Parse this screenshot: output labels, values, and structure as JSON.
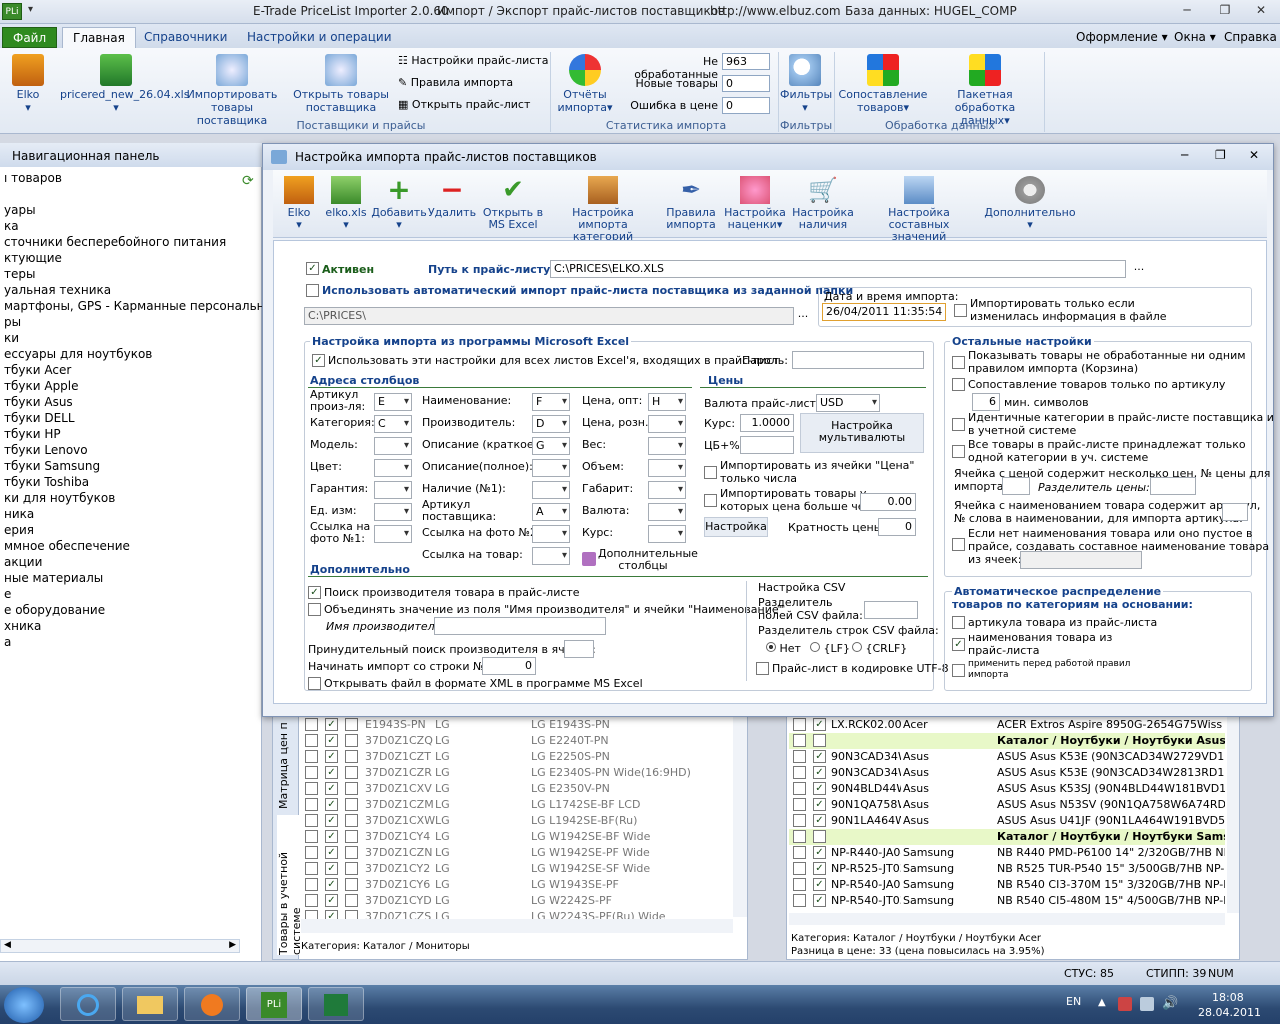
{
  "app": {
    "title_app": "E-Trade PriceList Importer 2.0.60",
    "title_desc": "Импорт / Экспорт прайс-листов поставщиков",
    "title_url": "http://www.elbuz.com",
    "title_db": "База данных: HUGEL_COMP",
    "logo": "PLi"
  },
  "tabs": {
    "file": "Файл",
    "main": "Главная",
    "refs": "Справочники",
    "settings": "Настройки и операции",
    "design": "Оформление",
    "windows": "Окна",
    "help": "Справка"
  },
  "ribbon": {
    "elko": "Elko",
    "file": "pricered_new_26.04.xls",
    "import1": "Импортировать",
    "import2": "товары поставщика",
    "open1": "Открыть товары",
    "open2": "поставщика",
    "set_price": "Настройки прайс-листа",
    "rules": "Правила импорта",
    "open_price": "Открыть прайс-лист",
    "grp1": "Поставщики и прайсы",
    "rep1": "Отчёты",
    "rep2": "импорта",
    "unproc_lbl": "Не обработанные",
    "unproc_val": "963",
    "new_lbl": "Новые товары",
    "new_val": "0",
    "err_lbl": "Ошибка в цене",
    "err_val": "0",
    "grp2": "Статистика импорта",
    "filt": "Фильтры",
    "grp3": "Фильтры",
    "match1": "Сопоставление",
    "match2": "товаров",
    "batch1": "Пакетная",
    "batch2": "обработка данных",
    "grp4": "Обработка данных"
  },
  "nav": {
    "header": "Навигационная панель",
    "items": [
      "ı товаров",
      "",
      "уары",
      "ка",
      "сточники бесперебойного питания",
      "ктующие",
      "теры",
      "уальная техника",
      "мартфоны, GPS - Карманные персональны",
      "ры",
      "ки",
      "ессуары для ноутбуков",
      "тбуки Acer",
      "тбуки Apple",
      "тбуки Asus",
      "тбуки DELL",
      "тбуки HP",
      "тбуки Lenovo",
      "тбуки Samsung",
      "тбуки Toshiba",
      "ки для ноутбуков",
      "ника",
      "ерия",
      "ммное обеспечение",
      "акции",
      "ные материалы",
      "е",
      "е оборудование",
      "хника",
      "а"
    ]
  },
  "left_grid": {
    "rows": [
      [
        "E1943S-PN",
        "LG",
        "LG E1943S-PN"
      ],
      [
        "37D0Z1CZQ",
        "LG",
        "LG E2240T-PN"
      ],
      [
        "37D0Z1CZT",
        "LG",
        "LG E2250S-PN"
      ],
      [
        "37D0Z1CZR",
        "LG",
        "LG E2340S-PN Wide(16:9HD)"
      ],
      [
        "37D0Z1CXV",
        "LG",
        "LG E2350V-PN"
      ],
      [
        "37D0Z1CZM",
        "LG",
        "LG L1742SE-BF LCD"
      ],
      [
        "37D0Z1CXW",
        "LG",
        "LG L1942SE-BF(Ru)"
      ],
      [
        "37D0Z1CY4",
        "LG",
        "LG W1942SE-BF Wide"
      ],
      [
        "37D0Z1CZN",
        "LG",
        "LG W1942SE-PF Wide"
      ],
      [
        "37D0Z1CY2",
        "LG",
        "LG W1942SE-SF Wide"
      ],
      [
        "37D0Z1CY6",
        "LG",
        "LG W1943SE-PF"
      ],
      [
        "37D0Z1CYD",
        "LG",
        "LG W2242S-PF"
      ],
      [
        "37D0Z1CZS",
        "LG",
        "LG W2243S-PF(Ru) Wide"
      ]
    ],
    "side1": "Матрица цен п",
    "side2": "Товары в учетной системе",
    "footer": "Категория: Каталог / Мониторы"
  },
  "right_grid": {
    "rows": [
      [
        "LX.RCK02.007",
        "Acer",
        "ACER Extros Aspire 8950G-2654G75Wiss Intel Core"
      ],
      [
        "",
        "",
        "Каталог / Ноутбуки / Ноутбуки Asus (5)"
      ],
      [
        "90N3CAD34W",
        "Asus",
        "ASUS Asus K53E (90N3CAD34W2729VD13AY) Cor"
      ],
      [
        "90N3CAD34W",
        "Asus",
        "ASUS Asus K53E (90N3CAD34W2813RD13AY) Cor"
      ],
      [
        "90N4BLD44W",
        "Asus",
        "ASUS Asus K53SJ (90N4BLD44W181BVD13AY) Cor"
      ],
      [
        "90N1QA758W",
        "Asus",
        "ASUS Asus N53SV (90N1QA758W6A74RD13AY) Cor"
      ],
      [
        "90N1LA464W",
        "Asus",
        "ASUS Asus U41JF (90N1LA464W191BVD53AY) Cor"
      ],
      [
        "",
        "",
        "Каталог / Ноутбуки / Ноутбуки Samsung"
      ],
      [
        "NP-R440-JA04",
        "Samsung",
        "NB R440 PMD-P6100 14\" 2/320GB/7HB NP-R440-J"
      ],
      [
        "NP-R525-JT03",
        "Samsung",
        "NB R525 TUR-P540 15\" 3/500GB/7HB NP-R525-JT0"
      ],
      [
        "NP-R540-JA08",
        "Samsung",
        "NB R540 CI3-370M 15\" 3/320GB/7HB NP-R540-JA"
      ],
      [
        "NP-R540-JT03",
        "Samsung",
        "NB R540 CI5-480M 15\" 4/500GB/7HB NP-R540-JT0"
      ]
    ],
    "footer1": "Категория: Каталог / Ноутбуки / Ноутбуки Acer",
    "footer2": "Разница в цене: 33  (цена повысилась на 3.95%)"
  },
  "dialog": {
    "title": "Настройка импорта прайс-листов поставщиков",
    "toolbar": {
      "elko": "Elko",
      "elko_xls": "elko.xls",
      "add": "Добавить",
      "del": "Удалить",
      "open_excel1": "Открыть в",
      "open_excel2": "MS Excel",
      "cat1": "Настройка импорта",
      "cat2": "категорий",
      "rules1": "Правила",
      "rules2": "импорта",
      "markup1": "Настройка",
      "markup2": "наценки",
      "avail1": "Настройка",
      "avail2": "наличия",
      "comp1": "Настройка составных",
      "comp2": "значений",
      "more": "Дополнительно"
    },
    "active": "Активен",
    "path_lbl": "Путь к прайс-листу:",
    "path_val": "C:\\PRICES\\ELKO.XLS",
    "auto_import": "Использовать автоматический импорт прайс-листа поставщика из заданной папки",
    "folder_val": "C:\\PRICES\\",
    "dt_lbl": "Дата и время импорта:",
    "dt_val": "26/04/2011 11:35:54",
    "only_changed1": "Импортировать только если",
    "only_changed2": "изменилась информация в файле",
    "excel_title": "Настройка импорта из программы Microsoft Excel",
    "all_sheets": "Использовать эти настройки для всех листов Excel'я, входящих в прайс-лист",
    "password": "Пароль:",
    "addr_title": "Адреса столбцов",
    "col1": [
      {
        "l1": "Артикул",
        "l2": "произ-ля:",
        "v": "E"
      },
      {
        "l1": "Категория:",
        "v": "C"
      },
      {
        "l1": "Модель:",
        "v": ""
      },
      {
        "l1": "Цвет:",
        "v": ""
      },
      {
        "l1": "Гарантия:",
        "v": ""
      },
      {
        "l1": "Ед. изм:",
        "v": ""
      },
      {
        "l1": "Ссылка на",
        "l2": "фото №1:",
        "v": ""
      }
    ],
    "col2": [
      {
        "l1": "Наименование:",
        "v": "F"
      },
      {
        "l1": "Производитель:",
        "v": "D"
      },
      {
        "l1": "Описание (краткое):",
        "v": "G"
      },
      {
        "l1": "Описание(полное):",
        "v": ""
      },
      {
        "l1": "Наличие (№1):",
        "v": ""
      },
      {
        "l1": "Артикул",
        "l2": "поставщика:",
        "v": "A"
      },
      {
        "l1": "Ссылка на фото №2:",
        "v": ""
      },
      {
        "l1": "Ссылка на товар:",
        "v": ""
      }
    ],
    "col3": [
      {
        "l1": "Цена, опт:",
        "v": "H"
      },
      {
        "l1": "Цена, розн.:",
        "v": ""
      },
      {
        "l1": "Вес:",
        "v": ""
      },
      {
        "l1": "Объем:",
        "v": ""
      },
      {
        "l1": "Габарит:",
        "v": ""
      },
      {
        "l1": "Валюта:",
        "v": ""
      },
      {
        "l1": "Курс:",
        "v": ""
      }
    ],
    "extra_cols1": "Дополнительные",
    "extra_cols2": "столбцы",
    "prices_title": "Цены",
    "currency_lbl": "Валюта прайс-листа:",
    "currency_val": "USD",
    "rate_lbl": "Курс:",
    "rate_val": "1.0000",
    "cb_lbl": "ЦБ+%",
    "multi1": "Настройка",
    "multi2": "мультивалюты",
    "only_nums1": "Импортировать из ячейки \"Цена\"",
    "only_nums2": "только числа",
    "gt1": "Импортировать товары у",
    "gt2": "которых цена больше чем:",
    "gt_val": "0.00",
    "setup": "Настройка",
    "mult_lbl": "Кратность цены:",
    "mult_val": "0",
    "extra_title": "Дополнительно",
    "find_maker": "Поиск производителя товара в прайс-листе",
    "merge": "Объединять значение из поля \"Имя производителя\" и ячейки \"Наименование\"",
    "maker_name": "Имя производителя:",
    "forced": "Принудительный поиск производителя в ячейке:",
    "start_row": "Начинать импорт со строки №:",
    "start_val": "0",
    "xml": "Открывать файл в формате XML в программе MS Excel",
    "csv_title": "Настройка CSV",
    "csv_sep1": "Разделитель",
    "csv_sep2": "полей CSV файла:",
    "csv_rows": "Разделитель строк CSV файла:",
    "r_none": "Нет",
    "r_lf": "{LF}",
    "r_crlf": "{CRLF}",
    "utf8": "Прайс-лист в кодировке UTF-8",
    "other_title": "Остальные настройки",
    "o1a": "Показывать товары не обработанные ни одним",
    "o1b": "правилом импорта (Корзина)",
    "o2": "Сопоставление товаров только по артикулу",
    "o2n": "6",
    "o2s": "мин. символов",
    "o3a": "Идентичные категории в прайс-листе поставщика и",
    "o3b": "в учетной системе",
    "o4a": "Все товары в прайс-листе принадлежат только",
    "o4b": "одной категории в уч. системе",
    "o5a": "Ячейка с ценой содержит несколько цен, № цены для",
    "o5b": "импорта:",
    "o5c": "Разделитель цены:",
    "o6a": "Ячейка с наименованием товара содержит артикул,",
    "o6b": "№ слова в наименовании, для импорта артикула:",
    "o7a": "Если нет наименования товара или оно пустое в",
    "o7b": "прайсе, создавать составное наименование товара",
    "o7c": "из ячеек:",
    "auto_title1": "Автоматическое распределение",
    "auto_title2": "товаров по категориям на основании:",
    "a1": "артикула товара из прайс-листа",
    "a2a": "наименования товара из",
    "a2b": "прайс-листа",
    "a3a": "применить перед работой правил",
    "a3b": "импорта"
  },
  "status": {
    "s1": "СТУС: 85",
    "s2": "СТИПП: 39",
    "s3": "NUM"
  },
  "taskbar": {
    "lang": "EN",
    "time": "18:08",
    "date": "28.04.2011"
  }
}
